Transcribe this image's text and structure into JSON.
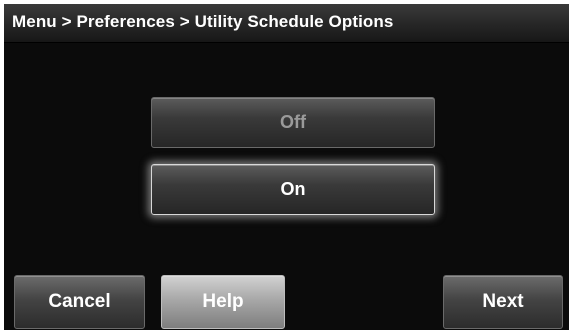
{
  "header": {
    "breadcrumb": "Menu > Preferences > Utility Schedule Options"
  },
  "options": {
    "off_label": "Off",
    "on_label": "On",
    "selected": "On"
  },
  "footer": {
    "cancel_label": "Cancel",
    "help_label": "Help",
    "next_label": "Next"
  }
}
